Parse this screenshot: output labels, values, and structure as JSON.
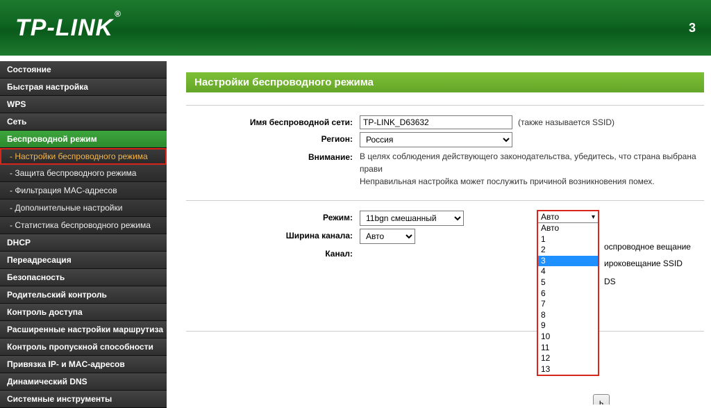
{
  "banner": {
    "logo": "TP-LINK",
    "model_trail": "3"
  },
  "sidebar": {
    "items": [
      {
        "label": "Состояние",
        "type": "top"
      },
      {
        "label": "Быстрая настройка",
        "type": "top"
      },
      {
        "label": "WPS",
        "type": "top"
      },
      {
        "label": "Сеть",
        "type": "top"
      },
      {
        "label": "Беспроводной режим",
        "type": "section-active"
      },
      {
        "label": "- Настройки беспроводного режима",
        "type": "sub-active"
      },
      {
        "label": "- Защита беспроводного режима",
        "type": "sub"
      },
      {
        "label": "- Фильтрация MAC-адресов",
        "type": "sub"
      },
      {
        "label": "- Дополнительные настройки",
        "type": "sub"
      },
      {
        "label": "- Статистика беспроводного режима",
        "type": "sub"
      },
      {
        "label": "DHCP",
        "type": "top"
      },
      {
        "label": "Переадресация",
        "type": "top"
      },
      {
        "label": "Безопасность",
        "type": "top"
      },
      {
        "label": "Родительский контроль",
        "type": "top"
      },
      {
        "label": "Контроль доступа",
        "type": "top"
      },
      {
        "label": "Расширенные настройки маршрутиза",
        "type": "top"
      },
      {
        "label": "Контроль пропускной способности",
        "type": "top"
      },
      {
        "label": "Привязка IP- и MAC-адресов",
        "type": "top"
      },
      {
        "label": "Динамический DNS",
        "type": "top"
      },
      {
        "label": "Системные инструменты",
        "type": "top"
      }
    ]
  },
  "page": {
    "title": "Настройки беспроводного режима",
    "labels": {
      "ssid": "Имя беспроводной сети:",
      "region": "Регион:",
      "warning": "Внимание:",
      "mode": "Режим:",
      "channel_width": "Ширина канала:",
      "channel": "Канал:"
    },
    "values": {
      "ssid": "TP-LINK_D63632",
      "ssid_note": "(также называется SSID)",
      "region": "Россия",
      "warning_text1": "В целях соблюдения действующего законодательства, убедитесь, что страна выбрана прави",
      "warning_text2": "Неправильная настройка может послужить причиной возникновения помех.",
      "mode": "11bgn смешанный",
      "channel_width": "Авто",
      "channel_selected": "Авто",
      "behind1": "оспроводное вещание",
      "behind2": "ироковещание SSID",
      "behind3": "DS",
      "save_fragment": "ь"
    },
    "channel_options": [
      "Авто",
      "1",
      "2",
      "3",
      "4",
      "5",
      "6",
      "7",
      "8",
      "9",
      "10",
      "11",
      "12",
      "13"
    ],
    "channel_highlight": "3"
  }
}
